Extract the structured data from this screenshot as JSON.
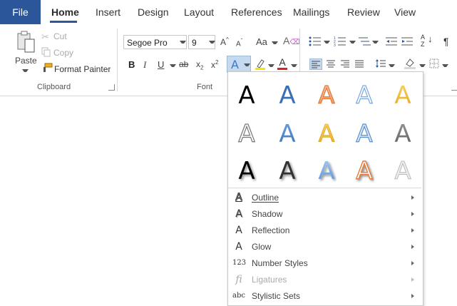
{
  "tabs": [
    "File",
    "Home",
    "Insert",
    "Design",
    "Layout",
    "References",
    "Mailings",
    "Review",
    "View"
  ],
  "clipboard": {
    "paste": "Paste",
    "cut": "Cut",
    "copy": "Copy",
    "format_painter": "Format Painter",
    "group_label": "Clipboard"
  },
  "font": {
    "name": "Segoe Pro",
    "size": "9",
    "group_label": "Font",
    "case_btn": "Aa",
    "bold": "B",
    "italic": "I",
    "underline": "U",
    "strike": "ab",
    "sub": "x",
    "sub2": "2",
    "sup": "x",
    "sup2": "2"
  },
  "paragraph": {
    "sort": "A",
    "sort2": "Z",
    "pilcrow": "¶"
  },
  "colors": {
    "accent": "#2b579a",
    "highlight": "#f5e400",
    "font_red": "#e02020"
  },
  "gallery": {
    "letter": "A",
    "menu": [
      {
        "icon": "A",
        "label": "Outline",
        "underline_char": "O",
        "enabled": true
      },
      {
        "icon": "A",
        "label": "Shadow",
        "underline_char": "S",
        "enabled": true
      },
      {
        "icon": "A",
        "label": "Reflection",
        "underline_char": "R",
        "enabled": true
      },
      {
        "icon": "A",
        "label": "Glow",
        "underline_char": "G",
        "enabled": true
      },
      {
        "icon": "123",
        "label": "Number Styles",
        "underline_char": "N",
        "enabled": true
      },
      {
        "icon": "fi",
        "label": "Ligatures",
        "underline_char": "L",
        "enabled": false
      },
      {
        "icon": "abc",
        "label": "Stylistic Sets",
        "underline_char": "t",
        "enabled": true
      }
    ]
  }
}
